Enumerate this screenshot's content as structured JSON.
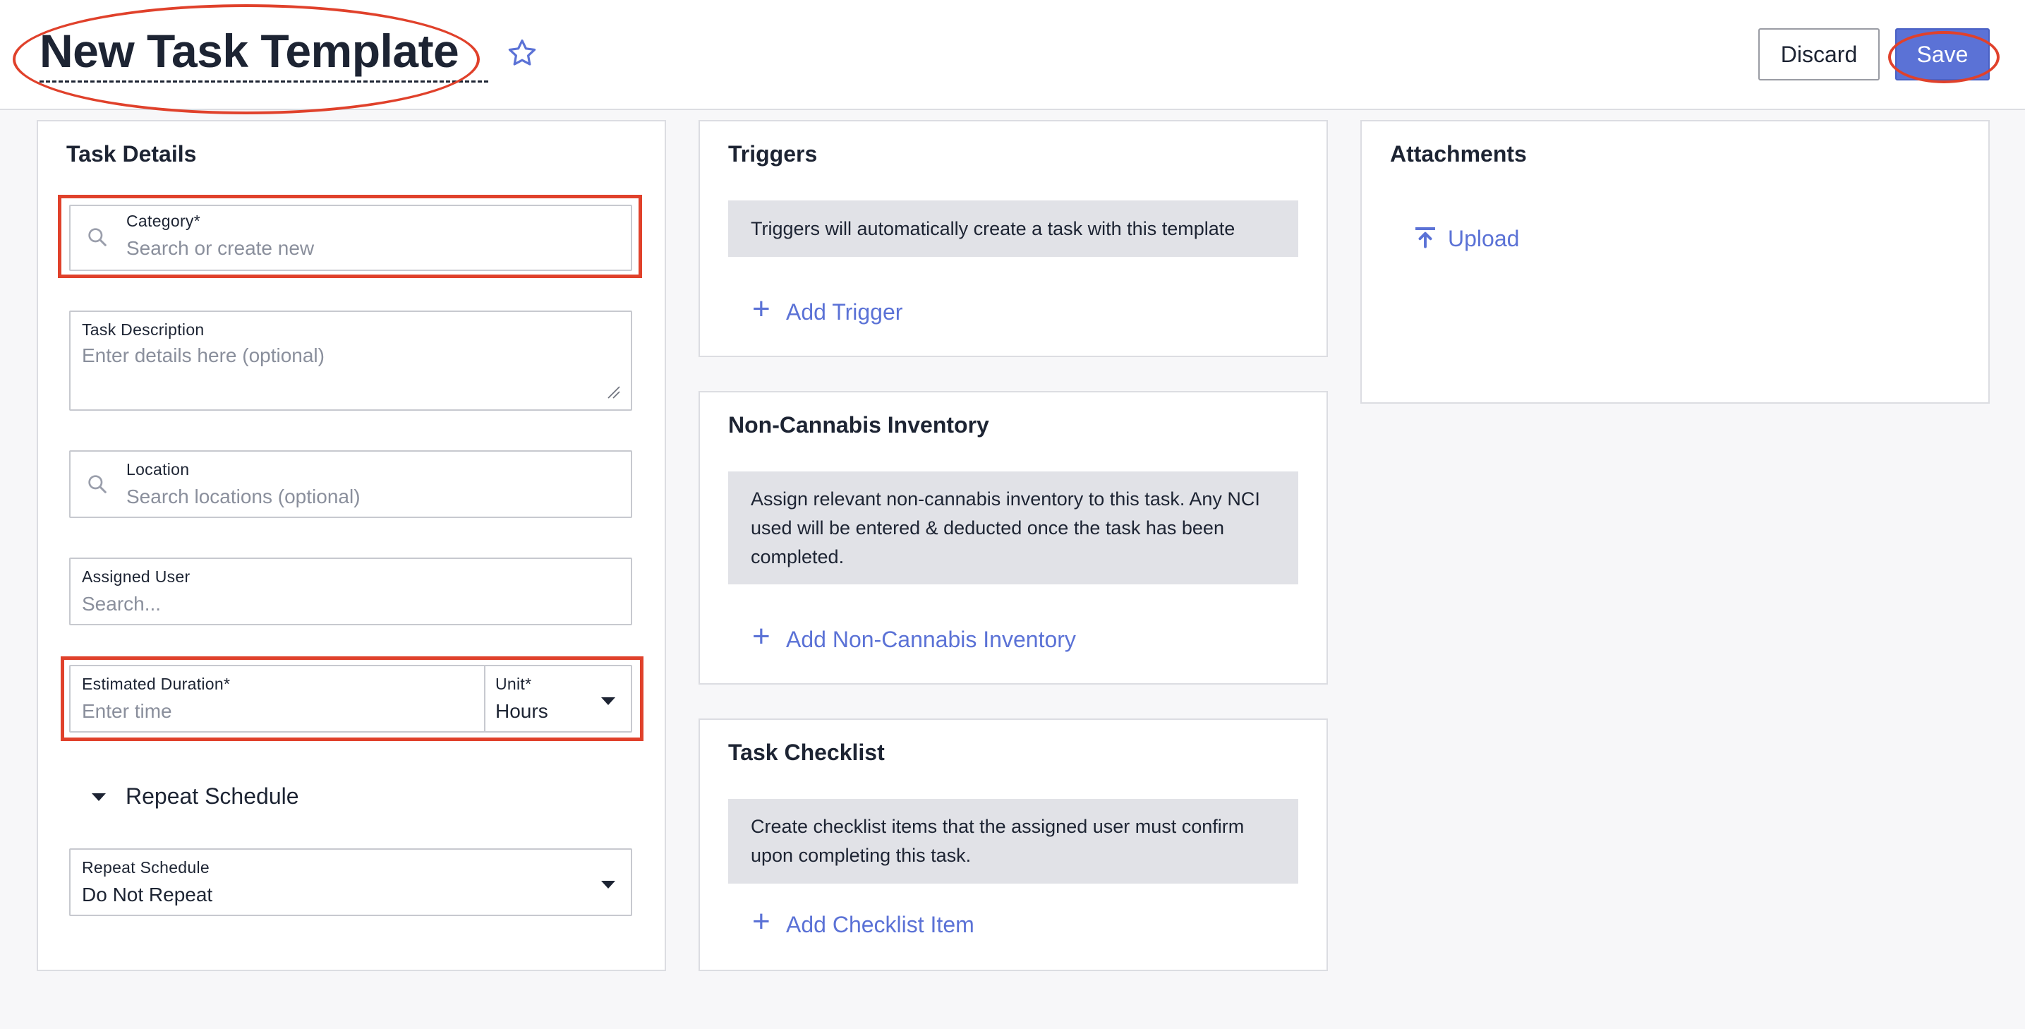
{
  "header": {
    "title": "New Task Template",
    "discard_label": "Discard",
    "save_label": "Save"
  },
  "task_details": {
    "heading": "Task Details",
    "category": {
      "label": "Category*",
      "placeholder": "Search or create new"
    },
    "description": {
      "label": "Task Description",
      "placeholder": "Enter details here (optional)"
    },
    "location": {
      "label": "Location",
      "placeholder": "Search locations (optional)"
    },
    "assigned_user": {
      "label": "Assigned User",
      "placeholder": "Search..."
    },
    "duration": {
      "label": "Estimated Duration*",
      "placeholder": "Enter time"
    },
    "unit": {
      "label": "Unit*",
      "value": "Hours"
    },
    "repeat_toggle": "Repeat Schedule",
    "repeat_schedule": {
      "label": "Repeat Schedule",
      "value": "Do Not Repeat"
    }
  },
  "triggers": {
    "heading": "Triggers",
    "info": "Triggers will automatically create a task with this template",
    "add_label": "Add Trigger"
  },
  "nci": {
    "heading": "Non-Cannabis Inventory",
    "info": "Assign relevant non-cannabis inventory to this task. Any NCI used will be entered & deducted once the task has been completed.",
    "add_label": "Add Non-Cannabis Inventory"
  },
  "checklist": {
    "heading": "Task Checklist",
    "info": "Create checklist items that the assigned user must confirm upon completing this task.",
    "add_label": "Add Checklist Item"
  },
  "attachments": {
    "heading": "Attachments",
    "upload_label": "Upload"
  },
  "icons": {
    "star": "star-outline-icon",
    "search": "search-icon",
    "plus": "plus-icon",
    "upload": "upload-icon",
    "caret": "caret-down-icon",
    "resize": "resize-handle-icon"
  },
  "colors": {
    "accent": "#5b72d6",
    "highlight": "#e0412b",
    "info_bg": "#e1e2e7",
    "page_bg": "#f7f7f9"
  }
}
